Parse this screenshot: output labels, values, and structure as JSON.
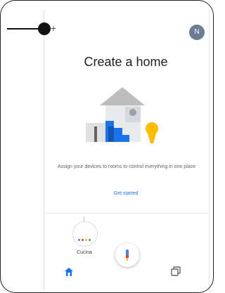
{
  "header": {
    "add_label": "+",
    "avatar_initial": "N"
  },
  "main": {
    "title": "Create a home",
    "description": "Assign your devices to rooms to control everything in one place",
    "cta_label": "Get started"
  },
  "devices": [
    {
      "name": "Cucina",
      "icon": "smart-speaker-icon"
    }
  ],
  "fab": {
    "icon": "microphone-icon"
  },
  "nav": [
    {
      "icon": "home-icon",
      "selected": true
    },
    {
      "icon": "feed-icon",
      "selected": false
    }
  ],
  "colors": {
    "accent": "#1a73e8",
    "illus_gray": "#9aa0a6",
    "illus_yellow": "#fbbc04",
    "illus_blue": "#1a73e8"
  }
}
